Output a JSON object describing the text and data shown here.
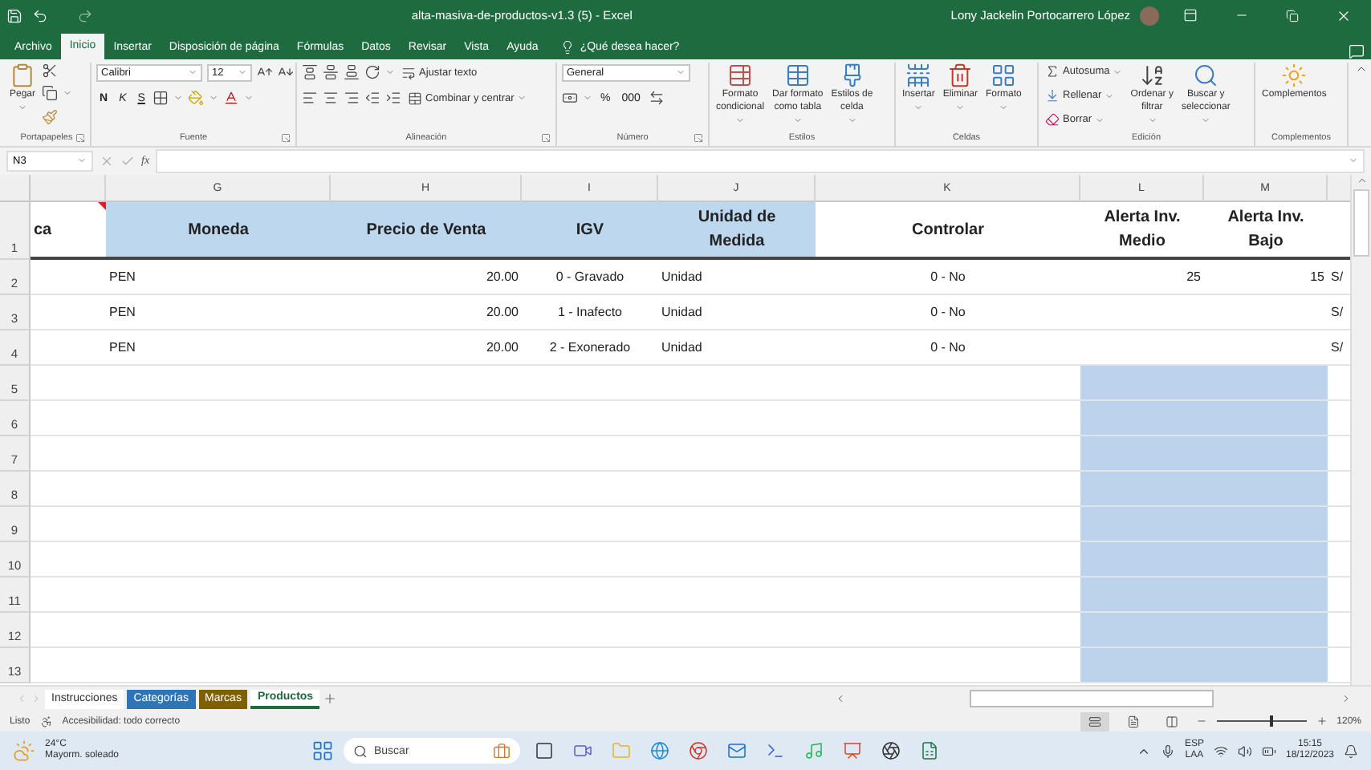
{
  "window": {
    "title": "alta-masiva-de-productos-v1.3 (5)  -  Excel",
    "user": "Lony Jackelin Portocarrero López"
  },
  "ribbon_tabs": [
    {
      "label": "Archivo",
      "selected": false
    },
    {
      "label": "Inicio",
      "selected": true
    },
    {
      "label": "Insertar",
      "selected": false
    },
    {
      "label": "Disposición de página",
      "selected": false
    },
    {
      "label": "Fórmulas",
      "selected": false
    },
    {
      "label": "Datos",
      "selected": false
    },
    {
      "label": "Revisar",
      "selected": false
    },
    {
      "label": "Vista",
      "selected": false
    },
    {
      "label": "Ayuda",
      "selected": false
    }
  ],
  "tell_me": {
    "placeholder": "¿Qué desea hacer?"
  },
  "ribbon_groups": [
    {
      "label": "Portapapeles",
      "items": [
        {
          "lines": [
            "Pegar"
          ]
        }
      ]
    },
    {
      "label": "Fuente",
      "items": [
        {
          "label": "Calibri"
        },
        {
          "label": "12"
        },
        {
          "label": "N"
        },
        {
          "label": "K"
        },
        {
          "label": "S"
        }
      ]
    },
    {
      "label": "Alineación",
      "items": [
        {
          "label": "Ajustar texto"
        },
        {
          "label": "Combinar y centrar"
        }
      ]
    },
    {
      "label": "Número",
      "items": [
        {
          "label": "General"
        },
        {
          "label": "%"
        },
        {
          "label": "000"
        }
      ]
    },
    {
      "label": "Estilos",
      "items": [
        {
          "lines": [
            "Formato",
            "condicional"
          ]
        },
        {
          "lines": [
            "Dar formato",
            "como tabla"
          ]
        },
        {
          "lines": [
            "Estilos de",
            "celda"
          ]
        }
      ]
    },
    {
      "label": "Celdas",
      "items": [
        {
          "lines": [
            "Insertar"
          ]
        },
        {
          "lines": [
            "Eliminar"
          ]
        },
        {
          "lines": [
            "Formato"
          ]
        }
      ]
    },
    {
      "label": "Edición",
      "items": [
        {
          "label": "Autosuma"
        },
        {
          "label": "Rellenar"
        },
        {
          "label": "Borrar"
        },
        {
          "lines": [
            "Ordenar y",
            "filtrar"
          ]
        },
        {
          "lines": [
            "Buscar y",
            "seleccionar"
          ]
        }
      ]
    },
    {
      "label": "Complementos",
      "items": [
        {
          "lines": [
            "Complementos"
          ]
        }
      ]
    }
  ],
  "formula_bar": {
    "name_box": "N3",
    "function_label": "fx"
  },
  "sheet": {
    "header_row": "1",
    "columns": [
      {
        "header": "ca",
        "color": "#ffffff",
        "kind": "text"
      },
      {
        "letter": "G",
        "header": "Moneda",
        "color": "#bdd7ee",
        "kind": "text"
      },
      {
        "letter": "H",
        "header": "Precio de Venta",
        "color": "#bdd7ee",
        "kind": "number"
      },
      {
        "letter": "I",
        "header": "IGV",
        "color": "#bdd7ee",
        "kind": "center"
      },
      {
        "letter": "J",
        "header": "Unidad de Medida",
        "color": "#bdd7ee",
        "kind": "text"
      },
      {
        "letter": "K",
        "header": "Controlar",
        "color": "#ffffff",
        "kind": "center"
      },
      {
        "letter": "L",
        "header": "Alerta Inv. Medio",
        "color": "#ffffff",
        "kind": "number"
      },
      {
        "letter": "M",
        "header": "Alerta Inv. Bajo",
        "color": "#ffffff",
        "kind": "number"
      },
      {
        "color": "#ffffff",
        "kind": "text"
      }
    ],
    "rows": [
      {
        "number": "2",
        "selected": false,
        "cells": [
          null,
          "PEN",
          "20.00",
          "0 - Gravado",
          "Unidad",
          "0 - No",
          "25",
          "15",
          "S/"
        ]
      },
      {
        "number": "3",
        "selected": false,
        "cells": [
          null,
          "PEN",
          "20.00",
          "1 - Inafecto",
          "Unidad",
          "0 - No",
          null,
          null,
          "S/"
        ]
      },
      {
        "number": "4",
        "selected": false,
        "cells": [
          null,
          "PEN",
          "20.00",
          "2 - Exonerado",
          "Unidad",
          "0 - No",
          null,
          null,
          "S/"
        ]
      },
      {
        "number": "5",
        "selected": true
      },
      {
        "number": "6",
        "selected": true
      },
      {
        "number": "7",
        "selected": true
      },
      {
        "number": "8",
        "selected": true
      },
      {
        "number": "9",
        "selected": true
      },
      {
        "number": "10",
        "selected": true
      },
      {
        "number": "11",
        "selected": true
      },
      {
        "number": "12",
        "selected": true
      },
      {
        "number": "13",
        "selected": true
      }
    ]
  },
  "sheet_tabs": [
    {
      "label": "Instrucciones",
      "color": "#ffffff",
      "selected": false
    },
    {
      "label": "Categorías",
      "color": "#2e75b6",
      "selected": false
    },
    {
      "label": "Marcas",
      "color": "#7f6000",
      "selected": false
    },
    {
      "label": "Productos",
      "color": "#ffffff",
      "selected": true
    }
  ],
  "status_bar": {
    "state": "Listo",
    "accessibility": "Accesibilidad: todo correcto",
    "zoom": "120%",
    "zoom_level": {
      "level": 0.6
    }
  },
  "taskbar": {
    "temperature": "24°C",
    "weather": "Mayorm. soleado",
    "search": {
      "placeholder": "Buscar"
    },
    "language": "ESP",
    "layout": "LAA",
    "time": "15:15",
    "date": "18/12/2023"
  }
}
